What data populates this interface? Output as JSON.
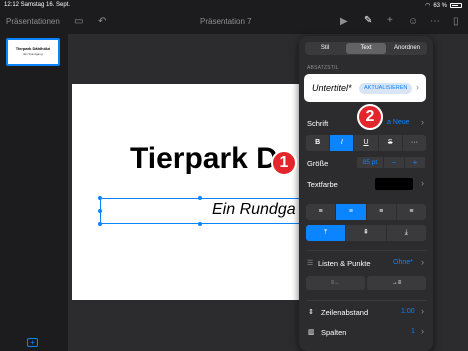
{
  "status_bar": {
    "time": "12:12  Samstag 16. Sept.",
    "battery": "63 %"
  },
  "toolbar": {
    "left_label": "Präsentationen",
    "doc_title": "Präsentation 7"
  },
  "sidebar": {
    "thumb_title": "Tierpark Dählhölzi",
    "thumb_subtitle": "Ein Rundgang",
    "thumb_number": "1"
  },
  "slide": {
    "title": "Tierpark D",
    "subtitle": "Ein Rundga"
  },
  "panel": {
    "tabs": [
      "Stil",
      "Text",
      "Anordnen"
    ],
    "active_tab": "Text",
    "paragraph_style_label": "ABSATZSTIL",
    "paragraph_style_value": "Untertitel*",
    "update_button": "AKTUALISIEREN",
    "font_label": "Schrift",
    "font_value": "a Neue",
    "format_buttons": [
      "B",
      "I",
      "U",
      "S",
      "···"
    ],
    "size_label": "Größe",
    "size_value": "85 pt",
    "size_minus": "−",
    "size_plus": "+",
    "text_color_label": "Textfarbe",
    "align_buttons": [
      "≡",
      "≡",
      "≡",
      "≡"
    ],
    "valign_buttons": [
      "⤒",
      "⇞",
      "⤓"
    ],
    "lists_label": "Listen & Punkte",
    "lists_value": "Ohne*",
    "indent_buttons": [
      "≡←",
      "→≡"
    ],
    "line_spacing_label": "Zeilenabstand",
    "line_spacing_value": "1.00",
    "columns_label": "Spalten",
    "columns_value": "1"
  },
  "badges": [
    "1",
    "2"
  ],
  "colors": {
    "accent": "#0a84ff",
    "badge": "#e3262b",
    "panel": "#2c2c2e"
  }
}
